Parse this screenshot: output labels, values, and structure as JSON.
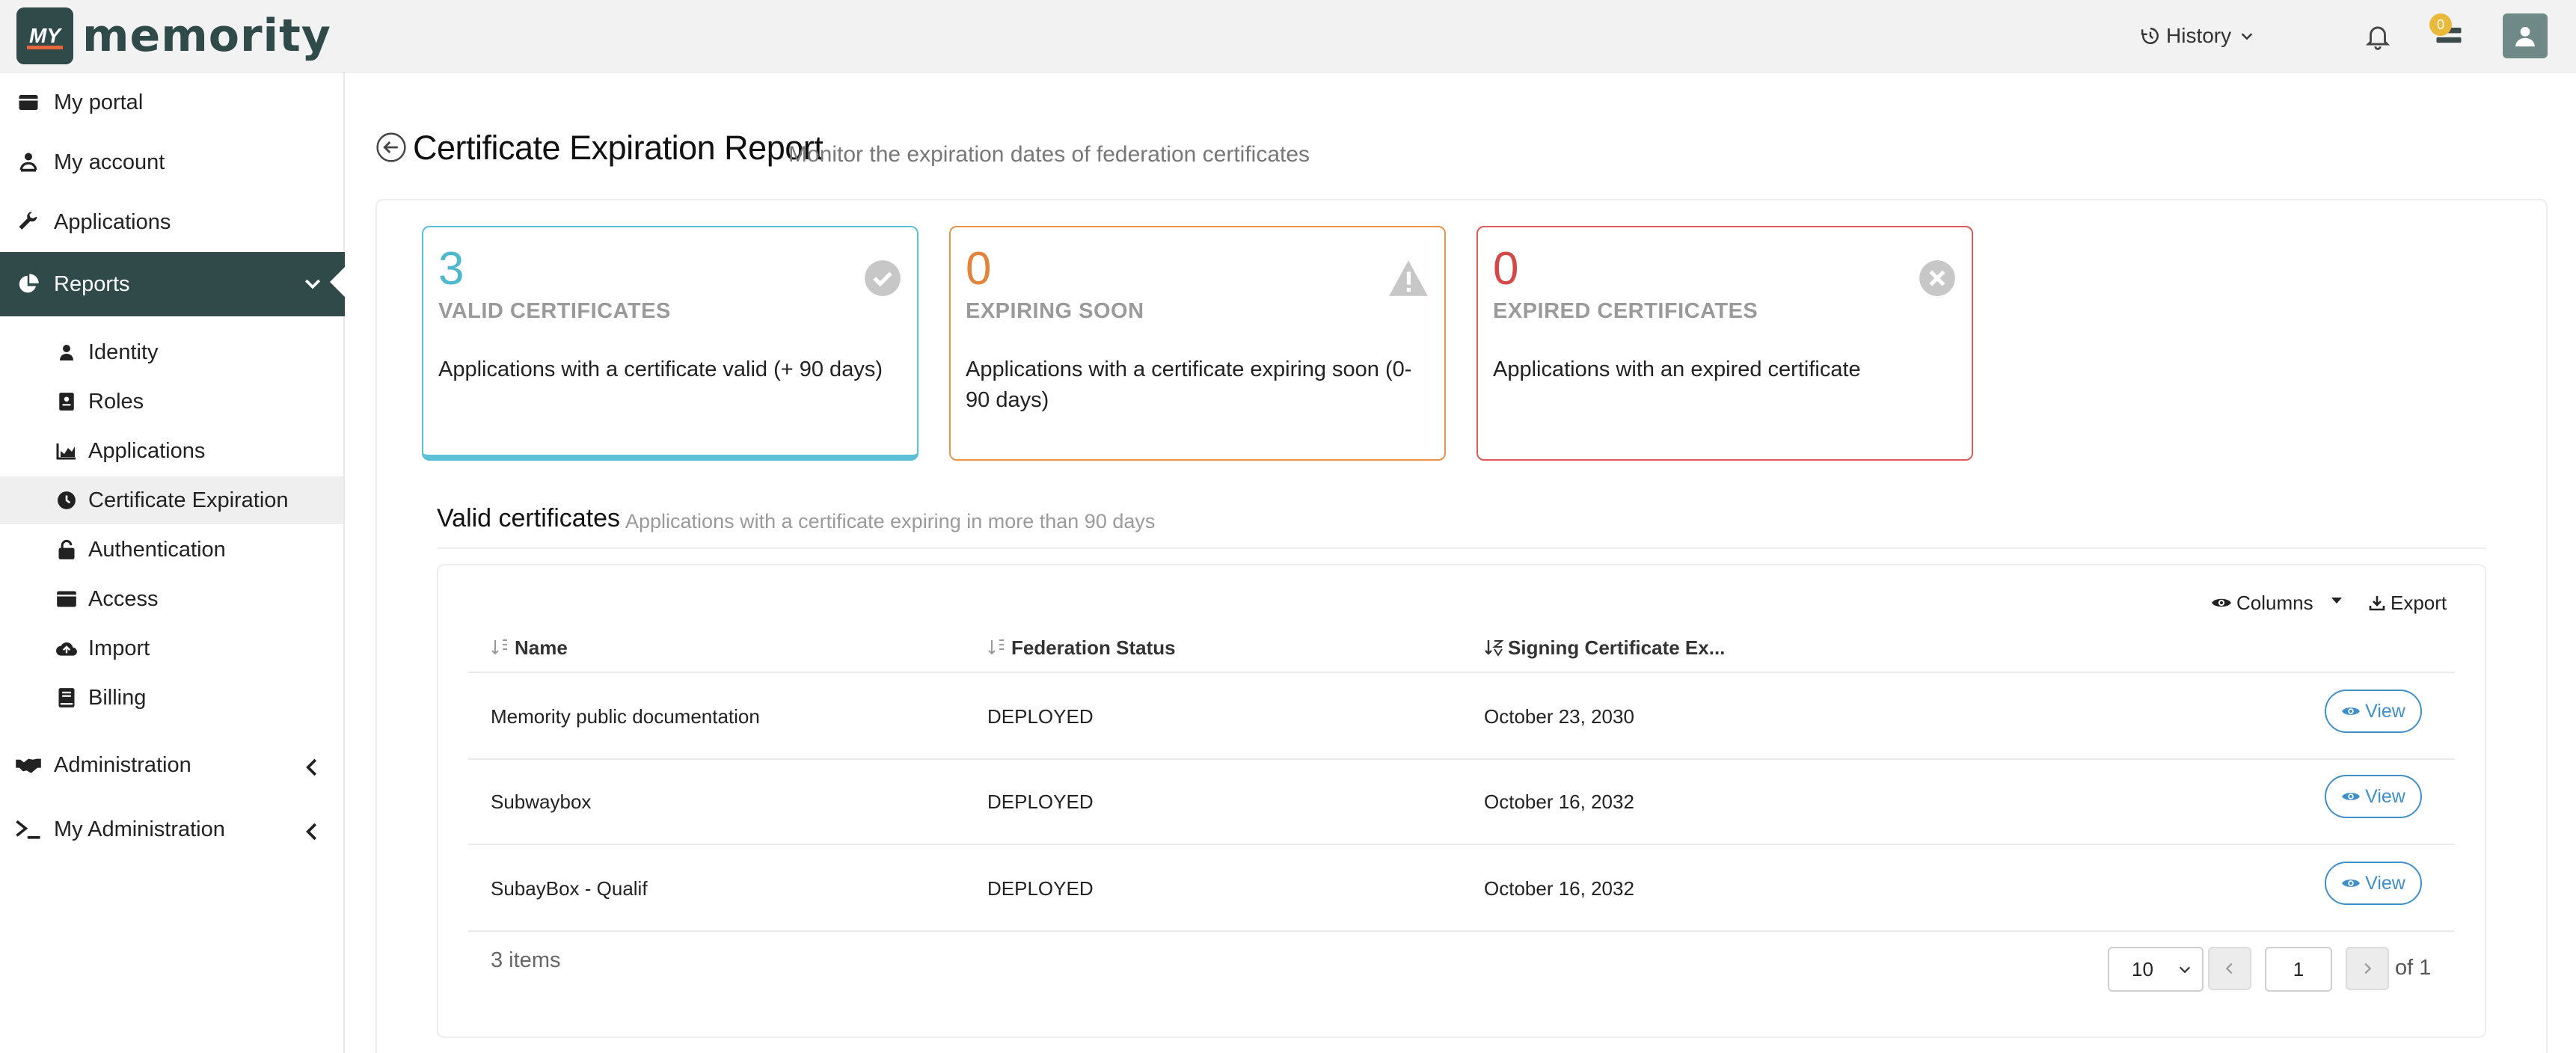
{
  "header": {
    "logo_mark": "MY",
    "logo_text": "memority",
    "history_label": "History",
    "tasks_badge": "0"
  },
  "sidebar": {
    "items": [
      {
        "label": "My portal",
        "icon": "portal-icon"
      },
      {
        "label": "My account",
        "icon": "account-icon"
      },
      {
        "label": "Applications",
        "icon": "wrench-icon"
      },
      {
        "label": "Reports",
        "icon": "pie-chart-icon"
      },
      {
        "label": "Administration",
        "icon": "handshake-icon"
      },
      {
        "label": "My Administration",
        "icon": "terminal-icon"
      }
    ],
    "sub_items": [
      {
        "label": "Identity",
        "icon": "user-icon"
      },
      {
        "label": "Roles",
        "icon": "id-badge-icon"
      },
      {
        "label": "Applications",
        "icon": "bar-chart-icon"
      },
      {
        "label": "Certificate Expiration",
        "icon": "clock-icon"
      },
      {
        "label": "Authentication",
        "icon": "lock-icon"
      },
      {
        "label": "Access",
        "icon": "card-icon"
      },
      {
        "label": "Import",
        "icon": "cloud-upload-icon"
      },
      {
        "label": "Billing",
        "icon": "book-icon"
      }
    ]
  },
  "page": {
    "title": "Certificate Expiration Report",
    "subtitle": "Monitor the expiration dates of federation certificates"
  },
  "cards": [
    {
      "value": "3",
      "label": "VALID CERTIFICATES",
      "description": "Applications with a certificate valid (+ 90 days)",
      "color": "#5bc0d6"
    },
    {
      "value": "0",
      "label": "EXPIRING SOON",
      "description": "Applications with a certificate expiring soon (0-90 days)",
      "color": "#e8924a"
    },
    {
      "value": "0",
      "label": "EXPIRED CERTIFICATES",
      "description": "Applications with an expired certificate",
      "color": "#dc5a5a"
    }
  ],
  "section": {
    "title": "Valid certificates",
    "subtitle": "Applications with a certificate expiring in more than 90 days"
  },
  "table": {
    "columns_label": "Columns",
    "export_label": "Export",
    "headers": [
      "Name",
      "Federation Status",
      "Signing Certificate Ex..."
    ],
    "view_label": "View",
    "rows": [
      {
        "name": "Memority public documentation",
        "status": "DEPLOYED",
        "expires": "October 23, 2030"
      },
      {
        "name": "Subwaybox",
        "status": "DEPLOYED",
        "expires": "October 16, 2032"
      },
      {
        "name": "SubayBox - Qualif",
        "status": "DEPLOYED",
        "expires": "October 16, 2032"
      }
    ],
    "items_count": "3 items",
    "page_size": "10",
    "current_page": "1",
    "of_pages": "of 1"
  }
}
